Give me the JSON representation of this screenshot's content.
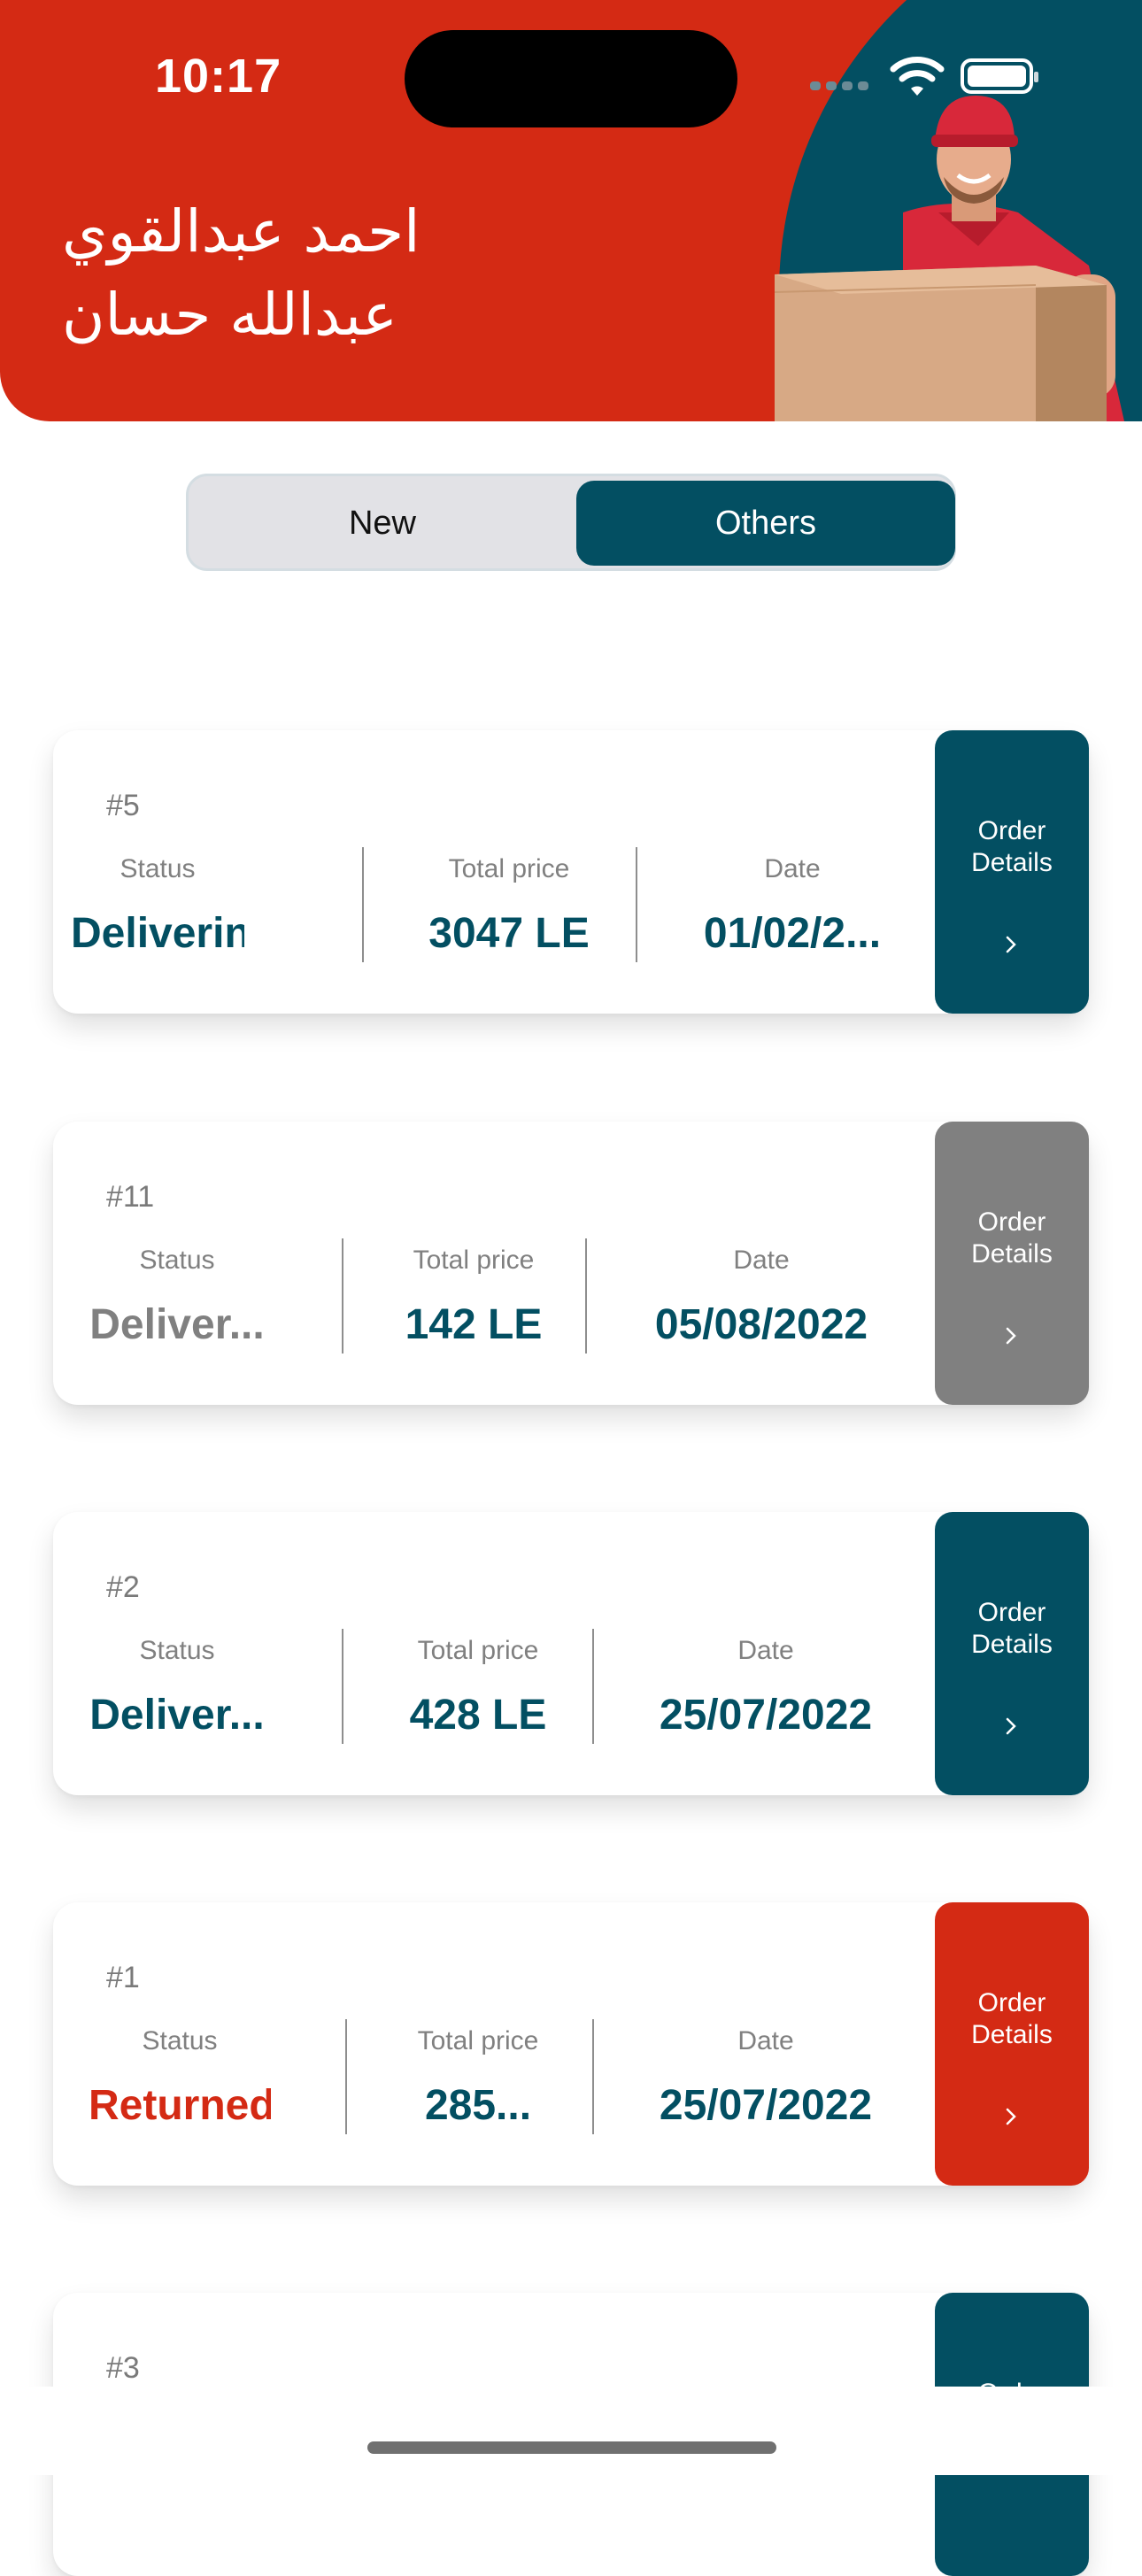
{
  "status_bar": {
    "time": "10:17"
  },
  "header": {
    "name_line1": "احمد عبدالقوي",
    "name_line2": "عبدالله حسان"
  },
  "tabs": {
    "new": "New",
    "others": "Others",
    "selected": "Others"
  },
  "colors": {
    "brand_red": "#D42A14",
    "brand_teal": "#034F62",
    "inactive_gray": "#808080"
  },
  "orders": [
    {
      "number": "#5",
      "status_label": "Status",
      "status": "Delivering",
      "price_label": "Total price",
      "price": "3047 LE",
      "date_label": "Date",
      "date": "01/02/2...",
      "button_line1": "Order",
      "button_line2": "Details",
      "accent": "teal"
    },
    {
      "number": "#11",
      "status_label": "Status",
      "status": "Deliver...",
      "price_label": "Total price",
      "price": "142 LE",
      "date_label": "Date",
      "date": "05/08/2022",
      "button_line1": "Order",
      "button_line2": "Details",
      "accent": "gray"
    },
    {
      "number": "#2",
      "status_label": "Status",
      "status": "Deliver...",
      "price_label": "Total price",
      "price": "428 LE",
      "date_label": "Date",
      "date": "25/07/2022",
      "button_line1": "Order",
      "button_line2": "Details",
      "accent": "teal"
    },
    {
      "number": "#1",
      "status_label": "Status",
      "status": "Returned",
      "price_label": "Total price",
      "price": "285...",
      "date_label": "Date",
      "date": "25/07/2022",
      "button_line1": "Order",
      "button_line2": "Details",
      "accent": "red"
    },
    {
      "number": "#3",
      "button_line1": "Order",
      "accent": "teal"
    }
  ]
}
